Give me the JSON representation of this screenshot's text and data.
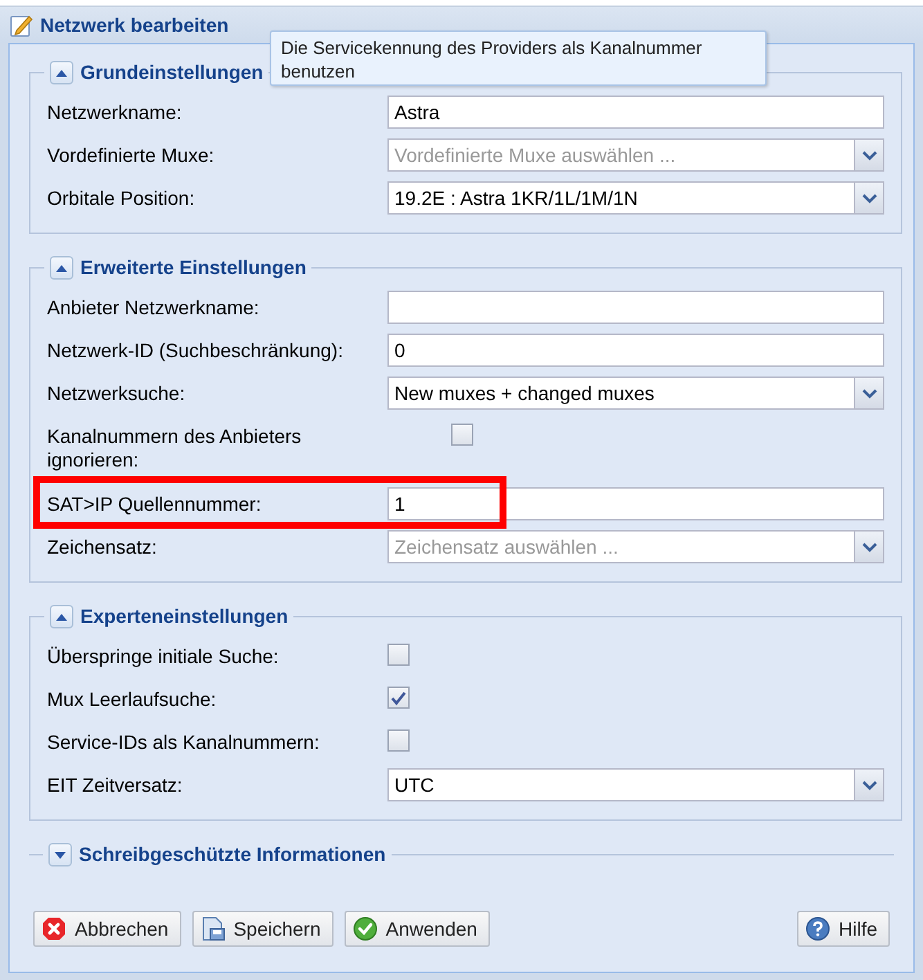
{
  "window": {
    "title": "Netzwerk bearbeiten"
  },
  "tooltip": {
    "text": "Die Servicekennung des Providers als Kanalnummer benutzen"
  },
  "sections": [
    {
      "title": "Grundeinstellungen",
      "expanded": true,
      "rows": [
        {
          "kind": "text",
          "label": "Netzwerkname:",
          "value": "Astra",
          "highlighted": false
        },
        {
          "kind": "combo",
          "label": "Vordefinierte Muxe:",
          "placeholder": "Vordefinierte Muxe auswählen ...",
          "highlighted": false
        },
        {
          "kind": "combo",
          "label": "Orbitale Position:",
          "value": "19.2E : Astra 1KR/1L/1M/1N",
          "highlighted": false
        }
      ]
    },
    {
      "title": "Erweiterte Einstellungen",
      "expanded": true,
      "rows": [
        {
          "kind": "text",
          "label": "Anbieter Netzwerkname:",
          "highlighted": false
        },
        {
          "kind": "text",
          "label": "Netzwerk-ID (Suchbeschränkung):",
          "value": "0",
          "highlighted": false
        },
        {
          "kind": "combo",
          "label": "Netzwerksuche:",
          "value": "New muxes + changed muxes",
          "highlighted": false
        },
        {
          "kind": "checkbox",
          "label": "Kanalnummern des Anbieters ignorieren:",
          "checked": false,
          "highlighted": false
        },
        {
          "kind": "text",
          "label": "SAT>IP Quellennummer:",
          "value": "1",
          "highlighted": true
        },
        {
          "kind": "combo",
          "label": "Zeichensatz:",
          "placeholder": "Zeichensatz auswählen ...",
          "highlighted": false
        }
      ]
    },
    {
      "title": "Experteneinstellungen",
      "expanded": true,
      "rows": [
        {
          "kind": "checkbox",
          "label": "Überspringe initiale Suche:",
          "checked": false,
          "highlighted": false
        },
        {
          "kind": "checkbox",
          "label": "Mux Leerlaufsuche:",
          "checked": true,
          "highlighted": false
        },
        {
          "kind": "checkbox",
          "label": "Service-IDs als Kanalnummern:",
          "checked": false,
          "highlighted": false
        },
        {
          "kind": "combo",
          "label": "EIT Zeitversatz:",
          "value": "UTC",
          "highlighted": false
        }
      ]
    },
    {
      "title": "Schreibgeschützte Informationen",
      "expanded": false
    }
  ],
  "buttons": [
    {
      "kind": "cancel",
      "label": "Abbrechen"
    },
    {
      "kind": "save",
      "label": "Speichern"
    },
    {
      "kind": "apply",
      "label": "Anwenden"
    },
    {
      "kind": "help",
      "label": "Hilfe"
    }
  ]
}
